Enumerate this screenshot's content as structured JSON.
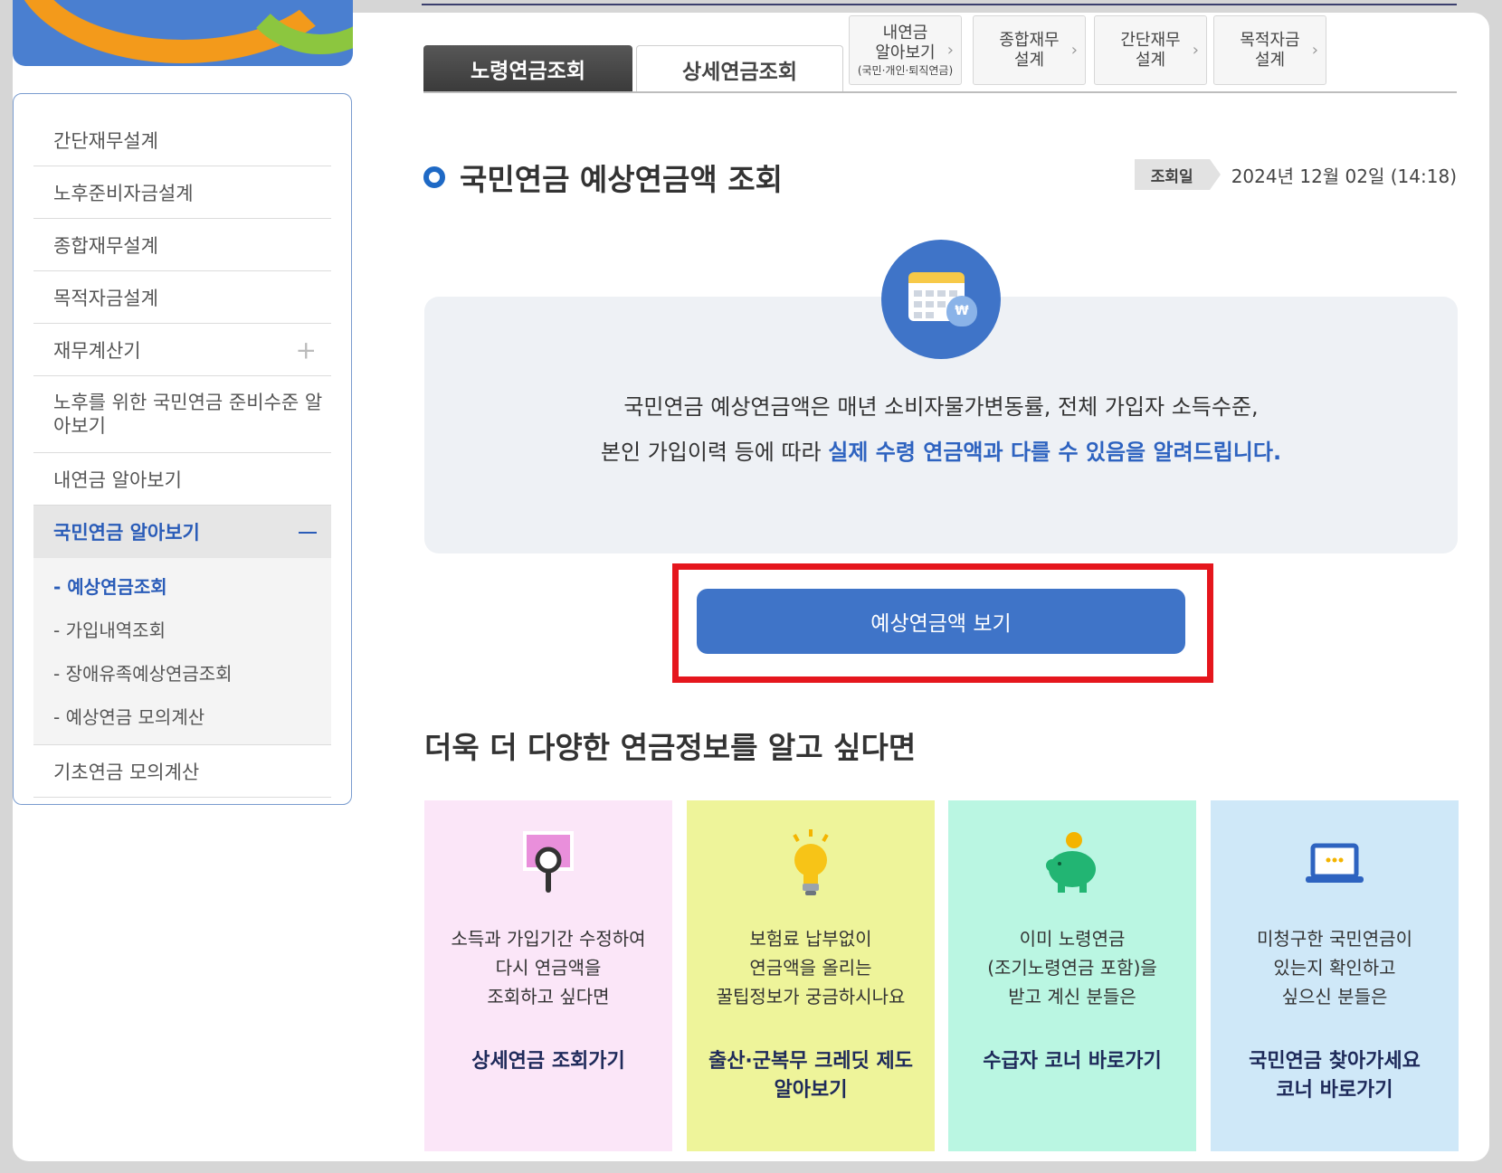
{
  "sidebar": {
    "items": [
      {
        "label": "간단재무설계"
      },
      {
        "label": "노후준비자금설계"
      },
      {
        "label": "종합재무설계"
      },
      {
        "label": "목적자금설계"
      },
      {
        "label": "재무계산기",
        "expand": "+"
      },
      {
        "label": "노후를 위한 국민연금 준비수준 알아보기"
      },
      {
        "label": "내연금 알아보기"
      },
      {
        "label": "국민연금 알아보기",
        "active": true
      },
      {
        "label": "기초연금 모의계산"
      }
    ],
    "sub_items": [
      {
        "label": "- 예상연금조회",
        "active": true
      },
      {
        "label": "- 가입내역조회"
      },
      {
        "label": "- 장애유족예상연금조회"
      },
      {
        "label": "- 예상연금 모의계산"
      }
    ]
  },
  "tabs": {
    "main": [
      {
        "label": "노령연금조회",
        "active": true
      },
      {
        "label": "상세연금조회"
      }
    ],
    "links": [
      {
        "label_line1": "내연금",
        "label_line2": "알아보기",
        "sub": "(국민·개인·퇴직연금)"
      },
      {
        "label_line1": "종합재무",
        "label_line2": "설계"
      },
      {
        "label_line1": "간단재무",
        "label_line2": "설계"
      },
      {
        "label_line1": "목적자금",
        "label_line2": "설계"
      }
    ],
    "chevron": "›"
  },
  "page": {
    "title": "국민연금 예상연금액 조회",
    "query_label": "조회일",
    "query_value": "2024년 12월 02일 (14:18)"
  },
  "notice": {
    "line1": "국민연금 예상연금액은 매년 소비자물가변동률, 전체 가입자 소득수준,",
    "line2_plain": "본인 가입이력 등에 따라 ",
    "line2_highlight": "실제 수령 연금액과 다를 수 있음을 알려드립니다.",
    "icon": "calendar-money-icon",
    "bag_symbol": "₩"
  },
  "main_button": {
    "label": "예상연금액 보기"
  },
  "more": {
    "title": "더욱 더 다양한 연금정보를 알고 싶다면",
    "cards": [
      {
        "desc1": "소득과 가입기간 수정하여",
        "desc2": "다시 연금액을",
        "desc3": "조회하고 싶다면",
        "link1": "상세연금 조회가기",
        "link2": "",
        "icon": "magnifier-icon",
        "bg": "#fbe6f8"
      },
      {
        "desc1": "보험료 납부없이",
        "desc2": "연금액을 올리는",
        "desc3": "꿀팁정보가 궁금하시나요",
        "link1": "출산·군복무 크레딧 제도",
        "link2": "알아보기",
        "icon": "lightbulb-icon",
        "bg": "#eef49a"
      },
      {
        "desc1": "이미 노령연금",
        "desc2": "(조기노령연금 포함)을",
        "desc3": "받고 계신 분들은",
        "link1": "수급자 코너 바로가기",
        "link2": "",
        "icon": "piggy-bank-icon",
        "bg": "#baf6e2"
      },
      {
        "desc1": "미청구한 국민연금이",
        "desc2": "있는지 확인하고",
        "desc3": "싶으신 분들은",
        "link1": "국민연금 찾아가세요",
        "link2": "코너 바로가기",
        "icon": "laptop-icon",
        "bg": "#cfe8f8"
      }
    ]
  },
  "colors": {
    "accent": "#3f74c8",
    "highlight_text": "#2e63c0",
    "annotation_box": "#e5161d"
  }
}
